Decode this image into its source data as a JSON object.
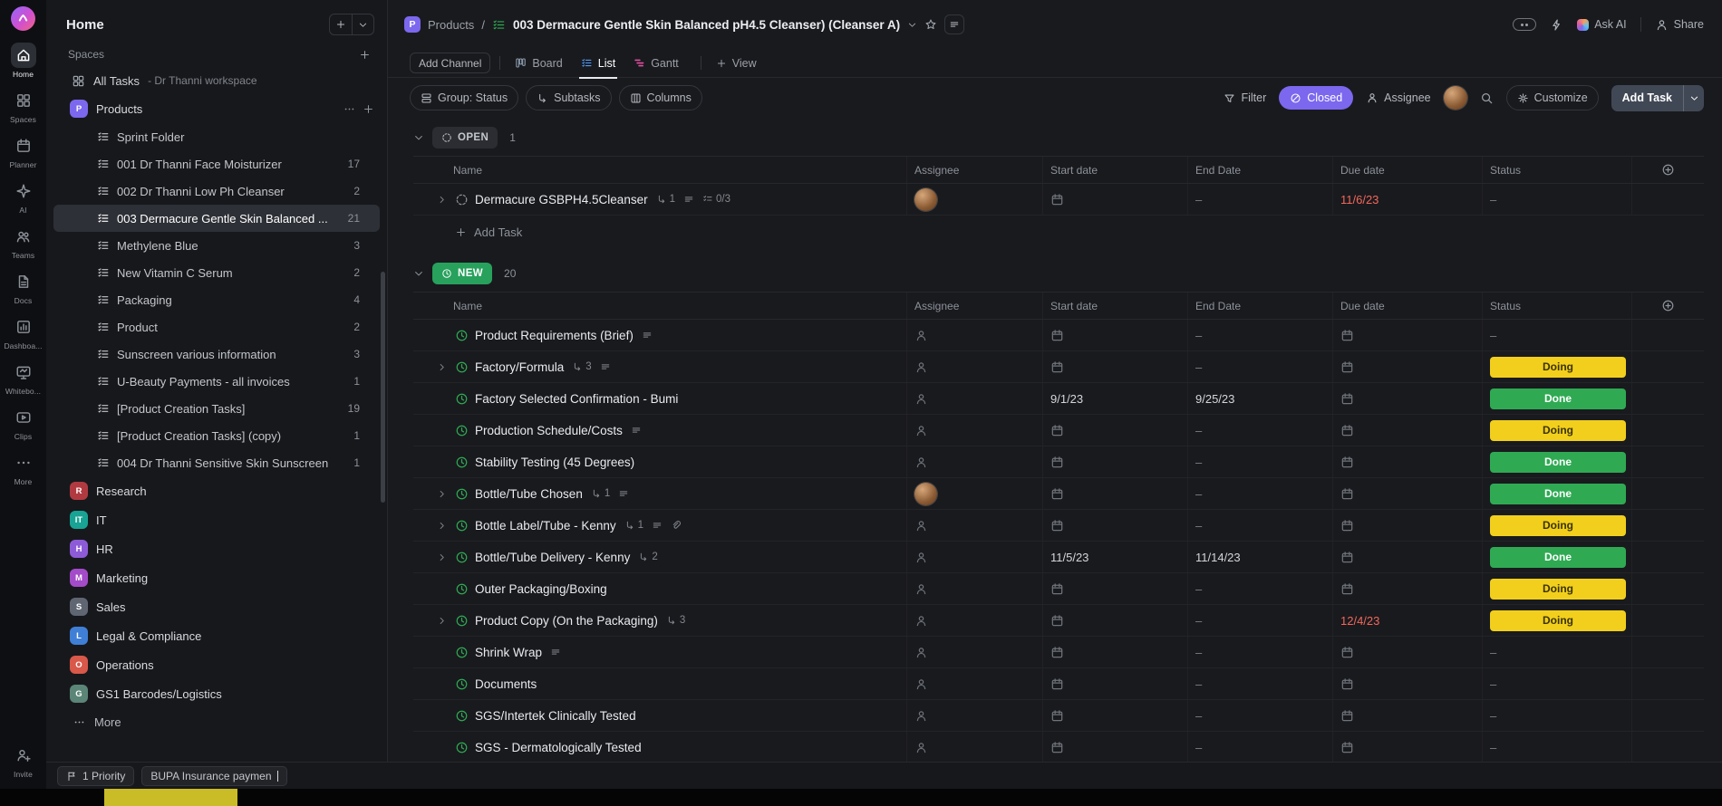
{
  "colors": {
    "accent_purple": "#7b68ee",
    "status_doing_bg": "#f2cf1d",
    "status_doing_text": "#3a3305",
    "status_done_bg": "#2faa53",
    "status_done_text": "#ffffff",
    "overdue_red": "#f2675a",
    "group_new_bg": "#27a15c"
  },
  "rail": {
    "items": [
      {
        "id": "home",
        "label": "Home",
        "icon": "home",
        "active": true
      },
      {
        "id": "spaces",
        "label": "Spaces",
        "icon": "spaces"
      },
      {
        "id": "planner",
        "label": "Planner",
        "icon": "planner"
      },
      {
        "id": "ai",
        "label": "AI",
        "icon": "ai"
      },
      {
        "id": "teams",
        "label": "Teams",
        "icon": "teams"
      },
      {
        "id": "docs",
        "label": "Docs",
        "icon": "docs"
      },
      {
        "id": "dashboards",
        "label": "Dashboa...",
        "icon": "dashboard"
      },
      {
        "id": "whiteboards",
        "label": "Whitebo...",
        "icon": "whiteboard"
      },
      {
        "id": "clips",
        "label": "Clips",
        "icon": "clips"
      },
      {
        "id": "more",
        "label": "More",
        "icon": "more"
      }
    ],
    "invite": {
      "label": "Invite",
      "icon": "invite"
    }
  },
  "sidebar": {
    "title": "Home",
    "spaces_label": "Spaces",
    "all_tasks": {
      "label": "All Tasks",
      "workspace": "-  Dr Thanni workspace"
    },
    "products": {
      "letter": "P",
      "label": "Products",
      "color": "#7b68ee"
    },
    "lists": [
      {
        "label": "Sprint Folder",
        "count": ""
      },
      {
        "label": "001 Dr Thanni Face Moisturizer",
        "count": "17"
      },
      {
        "label": "002 Dr Thanni Low Ph Cleanser",
        "count": "2"
      },
      {
        "label": "003 Dermacure Gentle Skin Balanced ...",
        "count": "21",
        "selected": true
      },
      {
        "label": "Methylene Blue",
        "count": "3"
      },
      {
        "label": "New Vitamin C Serum",
        "count": "2"
      },
      {
        "label": "Packaging",
        "count": "4"
      },
      {
        "label": "Product",
        "count": "2"
      },
      {
        "label": "Sunscreen various information",
        "count": "3"
      },
      {
        "label": "U-Beauty Payments - all invoices",
        "count": "1"
      },
      {
        "label": "[Product Creation Tasks]",
        "count": "19"
      },
      {
        "label": "[Product Creation Tasks] (copy)",
        "count": "1"
      },
      {
        "label": "004 Dr Thanni Sensitive Skin Sunscreen",
        "count": "1"
      }
    ],
    "spaces": [
      {
        "letter": "R",
        "label": "Research",
        "color": "#b13a41"
      },
      {
        "letter": "IT",
        "label": "IT",
        "color": "#18a394"
      },
      {
        "letter": "H",
        "label": "HR",
        "color": "#8d5bd8"
      },
      {
        "letter": "M",
        "label": "Marketing",
        "color": "#a34bc9"
      },
      {
        "letter": "S",
        "label": "Sales",
        "color": "#5f6672"
      },
      {
        "letter": "L",
        "label": "Legal & Compliance",
        "color": "#3f7fd6"
      },
      {
        "letter": "O",
        "label": "Operations",
        "color": "#d8584a"
      },
      {
        "letter": "G",
        "label": "GS1 Barcodes/Logistics",
        "color": "#5b8577"
      }
    ],
    "more_label": "More"
  },
  "header": {
    "breadcrumb": {
      "space_letter": "P",
      "space": "Products",
      "separator": "/",
      "title": "003 Dermacure Gentle Skin Balanced pH4.5 Cleanser) (Cleanser A)"
    },
    "ask_ai": "Ask AI",
    "share": "Share"
  },
  "viewbar": {
    "add_channel": "Add Channel",
    "tabs": [
      {
        "label": "Board"
      },
      {
        "label": "List",
        "active": true
      },
      {
        "label": "Gantt"
      }
    ],
    "add_view": "View"
  },
  "toolbar": {
    "group_by": "Group: Status",
    "subtasks": "Subtasks",
    "columns": "Columns",
    "filter": "Filter",
    "closed": "Closed",
    "assignee": "Assignee",
    "customize": "Customize",
    "add_task": "Add Task"
  },
  "table": {
    "columns": [
      "Name",
      "Assignee",
      "Start date",
      "End Date",
      "Due date",
      "Status"
    ],
    "empty_dash": "–"
  },
  "groups": [
    {
      "id": "open",
      "label": "OPEN",
      "count": "1",
      "type": "open",
      "add_task": "Add Task",
      "rows": [
        {
          "name": "Dermacure GSBPH4.5Cleanser",
          "expand": true,
          "subtasks": "1",
          "desc": true,
          "checklist": "0/3",
          "assignee": "avatar",
          "start": "",
          "end": "",
          "due": "11/6/23",
          "overdue": true,
          "status": ""
        }
      ]
    },
    {
      "id": "new",
      "label": "NEW",
      "count": "20",
      "type": "new",
      "rows": [
        {
          "name": "Product Requirements (Brief)",
          "desc": true,
          "assignee": "icon",
          "start": "",
          "end": "",
          "due": "",
          "status": ""
        },
        {
          "name": "Factory/Formula",
          "expand": true,
          "subtasks": "3",
          "desc": true,
          "assignee": "icon",
          "start": "",
          "end": "",
          "due": "",
          "status": "Doing"
        },
        {
          "name": "Factory Selected Confirmation - Bumi",
          "assignee": "icon",
          "start": "9/1/23",
          "end": "9/25/23",
          "due": "",
          "status": "Done"
        },
        {
          "name": "Production Schedule/Costs",
          "desc": true,
          "assignee": "icon",
          "start": "",
          "end": "",
          "due": "",
          "status": "Doing"
        },
        {
          "name": "Stability Testing (45 Degrees)",
          "assignee": "icon",
          "start": "",
          "end": "",
          "due": "",
          "status": "Done"
        },
        {
          "name": "Bottle/Tube Chosen",
          "expand": true,
          "subtasks": "1",
          "desc": true,
          "assignee": "avatar",
          "start": "",
          "end": "",
          "due": "",
          "status": "Done"
        },
        {
          "name": "Bottle Label/Tube - Kenny",
          "expand": true,
          "subtasks": "1",
          "desc": true,
          "attach": true,
          "assignee": "icon",
          "start": "",
          "end": "",
          "due": "",
          "status": "Doing"
        },
        {
          "name": "Bottle/Tube Delivery - Kenny",
          "expand": true,
          "subtasks": "2",
          "assignee": "icon",
          "start": "11/5/23",
          "end": "11/14/23",
          "due": "",
          "status": "Done"
        },
        {
          "name": "Outer Packaging/Boxing",
          "assignee": "icon",
          "start": "",
          "end": "",
          "due": "",
          "status": "Doing"
        },
        {
          "name": "Product Copy (On the Packaging)",
          "expand": true,
          "subtasks": "3",
          "assignee": "icon",
          "start": "",
          "end": "",
          "due": "12/4/23",
          "overdue": true,
          "status": "Doing"
        },
        {
          "name": "Shrink Wrap",
          "desc": true,
          "assignee": "icon",
          "start": "",
          "end": "",
          "due": "",
          "status": ""
        },
        {
          "name": "Documents",
          "assignee": "icon",
          "start": "",
          "end": "",
          "due": "",
          "status": ""
        },
        {
          "name": "SGS/Intertek Clinically Tested",
          "assignee": "icon",
          "start": "",
          "end": "",
          "due": "",
          "status": ""
        },
        {
          "name": "SGS - Dermatologically Tested",
          "assignee": "icon",
          "start": "",
          "end": "",
          "due": "",
          "status": ""
        }
      ]
    }
  ],
  "statusbar": {
    "chips": [
      {
        "label": "1 Priority"
      },
      {
        "label": "BUPA Insurance paymen"
      }
    ]
  }
}
